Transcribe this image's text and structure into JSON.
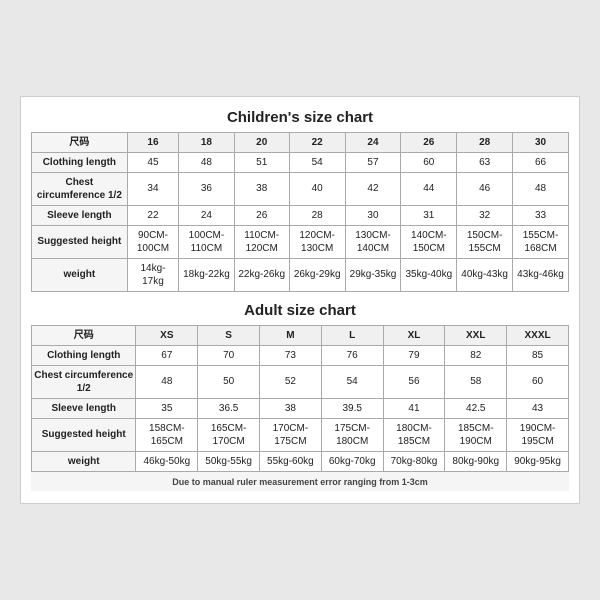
{
  "children_chart": {
    "title": "Children's size chart",
    "columns": [
      "尺码",
      "16",
      "18",
      "20",
      "22",
      "24",
      "26",
      "28",
      "30"
    ],
    "rows": [
      {
        "label": "Clothing length",
        "values": [
          "45",
          "48",
          "51",
          "54",
          "57",
          "60",
          "63",
          "66"
        ]
      },
      {
        "label": "Chest circumference 1/2",
        "values": [
          "34",
          "36",
          "38",
          "40",
          "42",
          "44",
          "46",
          "48"
        ]
      },
      {
        "label": "Sleeve length",
        "values": [
          "22",
          "24",
          "26",
          "28",
          "30",
          "31",
          "32",
          "33"
        ]
      },
      {
        "label": "Suggested height",
        "values": [
          "90CM-100CM",
          "100CM-110CM",
          "110CM-120CM",
          "120CM-130CM",
          "130CM-140CM",
          "140CM-150CM",
          "150CM-155CM",
          "155CM-168CM"
        ]
      },
      {
        "label": "weight",
        "values": [
          "14kg-17kg",
          "18kg-22kg",
          "22kg-26kg",
          "26kg-29kg",
          "29kg-35kg",
          "35kg-40kg",
          "40kg-43kg",
          "43kg-46kg"
        ]
      }
    ]
  },
  "adult_chart": {
    "title": "Adult size chart",
    "columns": [
      "尺码",
      "XS",
      "S",
      "M",
      "L",
      "XL",
      "XXL",
      "XXXL"
    ],
    "rows": [
      {
        "label": "Clothing length",
        "values": [
          "67",
          "70",
          "73",
          "76",
          "79",
          "82",
          "85"
        ]
      },
      {
        "label": "Chest circumference 1/2",
        "values": [
          "48",
          "50",
          "52",
          "54",
          "56",
          "58",
          "60"
        ]
      },
      {
        "label": "Sleeve length",
        "values": [
          "35",
          "36.5",
          "38",
          "39.5",
          "41",
          "42.5",
          "43"
        ]
      },
      {
        "label": "Suggested height",
        "values": [
          "158CM-165CM",
          "165CM-170CM",
          "170CM-175CM",
          "175CM-180CM",
          "180CM-185CM",
          "185CM-190CM",
          "190CM-195CM"
        ]
      },
      {
        "label": "weight",
        "values": [
          "46kg-50kg",
          "50kg-55kg",
          "55kg-60kg",
          "60kg-70kg",
          "70kg-80kg",
          "80kg-90kg",
          "90kg-95kg"
        ]
      }
    ]
  },
  "note": "Due to manual ruler measurement error ranging from 1-3cm"
}
